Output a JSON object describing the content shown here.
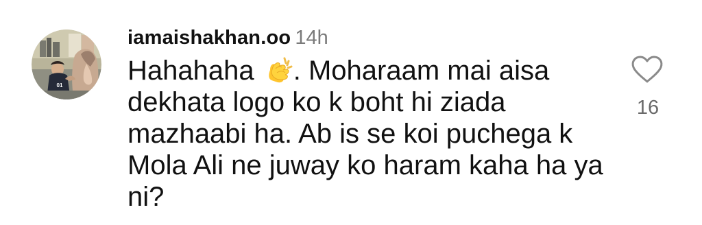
{
  "comment": {
    "username": "iamaishakhan.oo",
    "timestamp": "14h",
    "text_before_emoji": "Hahahaha ",
    "emoji": "clapping-hands",
    "text_after_emoji": ". Moharaam mai aisa dekhata logo ko k boht hi ziada mazhaabi ha. Ab is se koi puchega k Mola Ali ne juway ko haram kaha ha ya ni?",
    "like_count": "16"
  },
  "icons": {
    "avatar": "user-avatar-photo",
    "like": "heart-outline-icon",
    "emoji": "clapping-hands-emoji"
  },
  "colors": {
    "text": "#111111",
    "muted": "#7a7a7a",
    "like_count": "#6a6a6a",
    "background": "#ffffff"
  }
}
